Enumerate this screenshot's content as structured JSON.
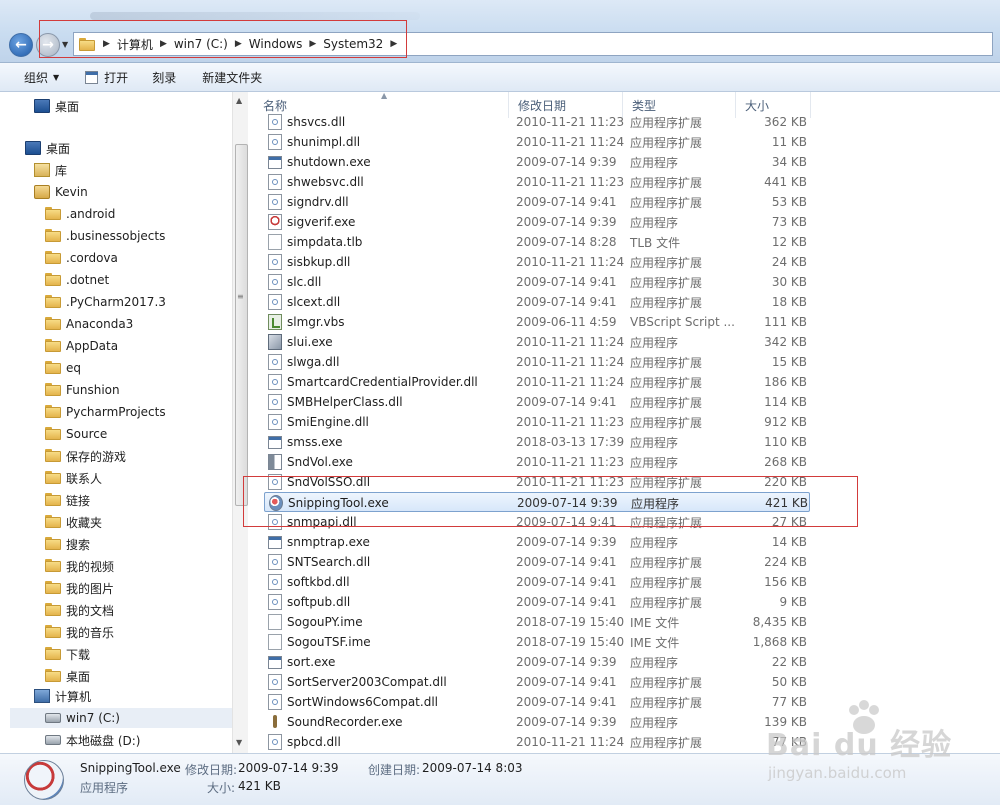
{
  "address": {
    "breadcrumbs": [
      "计算机",
      "win7 (C:)",
      "Windows",
      "System32"
    ]
  },
  "toolbar": {
    "organize": "组织",
    "open": "打开",
    "burn": "刻录",
    "new_folder": "新建文件夹"
  },
  "nav": {
    "items": [
      {
        "label": "桌面",
        "icon": "desktop-icon"
      },
      {
        "label": "桌面",
        "icon": "desktop-icon"
      },
      {
        "label": "库",
        "icon": "library-icon"
      },
      {
        "label": "Kevin",
        "icon": "user-folder-icon"
      },
      {
        "label": ".android",
        "icon": "folder-icon"
      },
      {
        "label": ".businessobjects",
        "icon": "folder-icon"
      },
      {
        "label": ".cordova",
        "icon": "folder-icon"
      },
      {
        "label": ".dotnet",
        "icon": "folder-icon"
      },
      {
        "label": ".PyCharm2017.3",
        "icon": "folder-icon"
      },
      {
        "label": "Anaconda3",
        "icon": "folder-icon"
      },
      {
        "label": "AppData",
        "icon": "folder-icon"
      },
      {
        "label": "eq",
        "icon": "folder-icon"
      },
      {
        "label": "Funshion",
        "icon": "folder-icon"
      },
      {
        "label": "PycharmProjects",
        "icon": "folder-icon"
      },
      {
        "label": "Source",
        "icon": "folder-icon"
      },
      {
        "label": "保存的游戏",
        "icon": "folder-icon"
      },
      {
        "label": "联系人",
        "icon": "folder-icon"
      },
      {
        "label": "链接",
        "icon": "folder-icon"
      },
      {
        "label": "收藏夹",
        "icon": "folder-icon"
      },
      {
        "label": "搜索",
        "icon": "folder-icon"
      },
      {
        "label": "我的视频",
        "icon": "folder-icon"
      },
      {
        "label": "我的图片",
        "icon": "folder-icon"
      },
      {
        "label": "我的文档",
        "icon": "folder-icon"
      },
      {
        "label": "我的音乐",
        "icon": "folder-icon"
      },
      {
        "label": "下载",
        "icon": "folder-icon"
      },
      {
        "label": "桌面",
        "icon": "folder-icon"
      },
      {
        "label": "计算机",
        "icon": "computer-icon"
      },
      {
        "label": "win7 (C:)",
        "icon": "drive-icon"
      },
      {
        "label": "本地磁盘 (D:)",
        "icon": "drive-icon"
      }
    ]
  },
  "columns": {
    "name": "名称",
    "date": "修改日期",
    "type": "类型",
    "size": "大小"
  },
  "files": [
    {
      "name": "shsvcs.dll",
      "date": "2010-11-21 11:23",
      "type": "应用程序扩展",
      "size": "362 KB",
      "icon": "dll"
    },
    {
      "name": "shunimpl.dll",
      "date": "2010-11-21 11:24",
      "type": "应用程序扩展",
      "size": "11 KB",
      "icon": "dll"
    },
    {
      "name": "shutdown.exe",
      "date": "2009-07-14 9:39",
      "type": "应用程序",
      "size": "34 KB",
      "icon": "exe"
    },
    {
      "name": "shwebsvc.dll",
      "date": "2010-11-21 11:23",
      "type": "应用程序扩展",
      "size": "441 KB",
      "icon": "dll"
    },
    {
      "name": "signdrv.dll",
      "date": "2009-07-14 9:41",
      "type": "应用程序扩展",
      "size": "53 KB",
      "icon": "dll"
    },
    {
      "name": "sigverif.exe",
      "date": "2009-07-14 9:39",
      "type": "应用程序",
      "size": "73 KB",
      "icon": "app"
    },
    {
      "name": "simpdata.tlb",
      "date": "2009-07-14 8:28",
      "type": "TLB 文件",
      "size": "12 KB",
      "icon": "tlb"
    },
    {
      "name": "sisbkup.dll",
      "date": "2010-11-21 11:24",
      "type": "应用程序扩展",
      "size": "24 KB",
      "icon": "dll"
    },
    {
      "name": "slc.dll",
      "date": "2009-07-14 9:41",
      "type": "应用程序扩展",
      "size": "30 KB",
      "icon": "dll"
    },
    {
      "name": "slcext.dll",
      "date": "2009-07-14 9:41",
      "type": "应用程序扩展",
      "size": "18 KB",
      "icon": "dll"
    },
    {
      "name": "slmgr.vbs",
      "date": "2009-06-11 4:59",
      "type": "VBScript Script ...",
      "size": "111 KB",
      "icon": "vbs"
    },
    {
      "name": "slui.exe",
      "date": "2010-11-21 11:24",
      "type": "应用程序",
      "size": "342 KB",
      "icon": "tool"
    },
    {
      "name": "slwga.dll",
      "date": "2010-11-21 11:24",
      "type": "应用程序扩展",
      "size": "15 KB",
      "icon": "dll"
    },
    {
      "name": "SmartcardCredentialProvider.dll",
      "date": "2010-11-21 11:24",
      "type": "应用程序扩展",
      "size": "186 KB",
      "icon": "dll"
    },
    {
      "name": "SMBHelperClass.dll",
      "date": "2009-07-14 9:41",
      "type": "应用程序扩展",
      "size": "114 KB",
      "icon": "dll"
    },
    {
      "name": "SmiEngine.dll",
      "date": "2010-11-21 11:23",
      "type": "应用程序扩展",
      "size": "912 KB",
      "icon": "dll"
    },
    {
      "name": "smss.exe",
      "date": "2018-03-13 17:39",
      "type": "应用程序",
      "size": "110 KB",
      "icon": "exe"
    },
    {
      "name": "SndVol.exe",
      "date": "2010-11-21 11:23",
      "type": "应用程序",
      "size": "268 KB",
      "icon": "vol"
    },
    {
      "name": "SndVolSSO.dll",
      "date": "2010-11-21 11:23",
      "type": "应用程序扩展",
      "size": "220 KB",
      "icon": "dll"
    },
    {
      "name": "SnippingTool.exe",
      "date": "2009-07-14 9:39",
      "type": "应用程序",
      "size": "421 KB",
      "icon": "snip",
      "selected": true
    },
    {
      "name": "snmpapi.dll",
      "date": "2009-07-14 9:41",
      "type": "应用程序扩展",
      "size": "27 KB",
      "icon": "dll"
    },
    {
      "name": "snmptrap.exe",
      "date": "2009-07-14 9:39",
      "type": "应用程序",
      "size": "14 KB",
      "icon": "exe"
    },
    {
      "name": "SNTSearch.dll",
      "date": "2009-07-14 9:41",
      "type": "应用程序扩展",
      "size": "224 KB",
      "icon": "dll"
    },
    {
      "name": "softkbd.dll",
      "date": "2009-07-14 9:41",
      "type": "应用程序扩展",
      "size": "156 KB",
      "icon": "dll"
    },
    {
      "name": "softpub.dll",
      "date": "2009-07-14 9:41",
      "type": "应用程序扩展",
      "size": "9 KB",
      "icon": "dll"
    },
    {
      "name": "SogouPY.ime",
      "date": "2018-07-19 15:40",
      "type": "IME 文件",
      "size": "8,435 KB",
      "icon": "ime"
    },
    {
      "name": "SogouTSF.ime",
      "date": "2018-07-19 15:40",
      "type": "IME 文件",
      "size": "1,868 KB",
      "icon": "ime"
    },
    {
      "name": "sort.exe",
      "date": "2009-07-14 9:39",
      "type": "应用程序",
      "size": "22 KB",
      "icon": "exe"
    },
    {
      "name": "SortServer2003Compat.dll",
      "date": "2009-07-14 9:41",
      "type": "应用程序扩展",
      "size": "50 KB",
      "icon": "dll"
    },
    {
      "name": "SortWindows6Compat.dll",
      "date": "2009-07-14 9:41",
      "type": "应用程序扩展",
      "size": "77 KB",
      "icon": "dll"
    },
    {
      "name": "SoundRecorder.exe",
      "date": "2009-07-14 9:39",
      "type": "应用程序",
      "size": "139 KB",
      "icon": "rec"
    },
    {
      "name": "spbcd.dll",
      "date": "2010-11-21 11:24",
      "type": "应用程序扩展",
      "size": "77 KB",
      "icon": "dll"
    }
  ],
  "details": {
    "name": "SnippingTool.exe",
    "modified_label": "修改日期:",
    "modified_value": "2009-07-14 9:39",
    "created_label": "创建日期:",
    "created_value": "2009-07-14 8:03",
    "type": "应用程序",
    "size_label": "大小:",
    "size_value": "421 KB"
  },
  "watermark": {
    "brand": "Bai du 经验",
    "url": "jingyan.baidu.com"
  },
  "colors": {
    "selection_border": "#7da2ce",
    "annotation_red": "#d23b3b",
    "header_text": "#4c607a"
  }
}
